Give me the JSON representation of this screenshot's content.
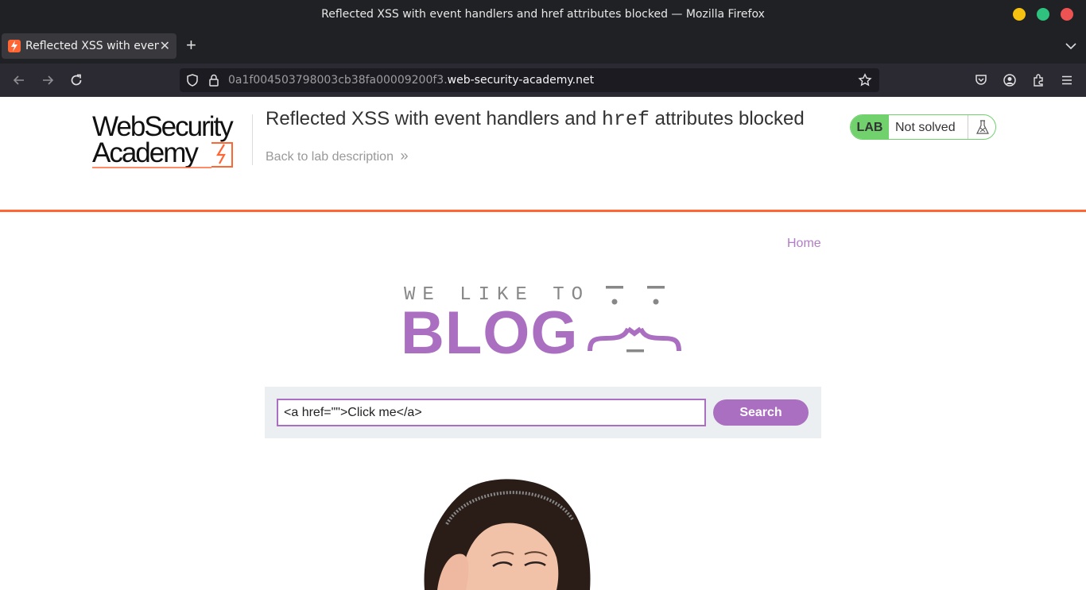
{
  "window": {
    "title": "Reflected XSS with event handlers and href attributes blocked — Mozilla Firefox"
  },
  "browser": {
    "tab_title": "Reflected XSS with event handlers and href attributes blocked",
    "url_subdomain": "0a1f004503798003cb38fa00009200f3.",
    "url_domain": "web-security-academy.net"
  },
  "header": {
    "logo_line1": "WebSecurity",
    "logo_line2": "Academy",
    "lab_title_before": "Reflected XSS with event handlers and ",
    "lab_title_code": "href",
    "lab_title_after": " attributes blocked",
    "back_link": "Back to lab description",
    "back_chevron": "»",
    "status_tag": "LAB",
    "status_text": "Not solved"
  },
  "nav": {
    "home": "Home"
  },
  "blog": {
    "tagline": "WE LIKE TO",
    "wordmark": "BLOG"
  },
  "search": {
    "value": "<a href=\"\">Click me</a>",
    "button": "Search"
  },
  "colors": {
    "accent": "#ab6fc1",
    "brand_orange": "#ff6633",
    "status_green": "#70d16d"
  }
}
